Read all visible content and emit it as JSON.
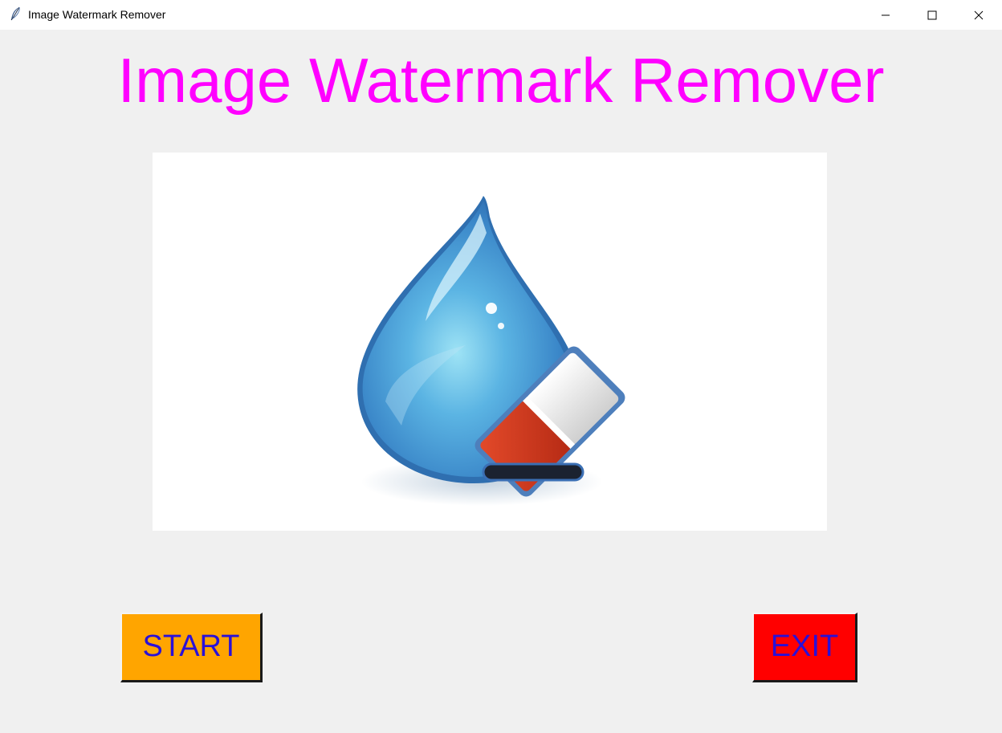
{
  "window": {
    "title": "Image Watermark Remover",
    "icons": {
      "app": "feather-icon",
      "minimize": "minimize-icon",
      "maximize": "maximize-icon",
      "close": "close-icon"
    }
  },
  "main": {
    "heading": "Image Watermark Remover",
    "heading_color": "#ff00ff",
    "logo": "water-drop-eraser-logo"
  },
  "buttons": {
    "start": {
      "label": "START",
      "bg": "#ffa500",
      "fg": "#2a10d8"
    },
    "exit": {
      "label": "EXIT",
      "bg": "#ff0000",
      "fg": "#2a10d8"
    }
  }
}
